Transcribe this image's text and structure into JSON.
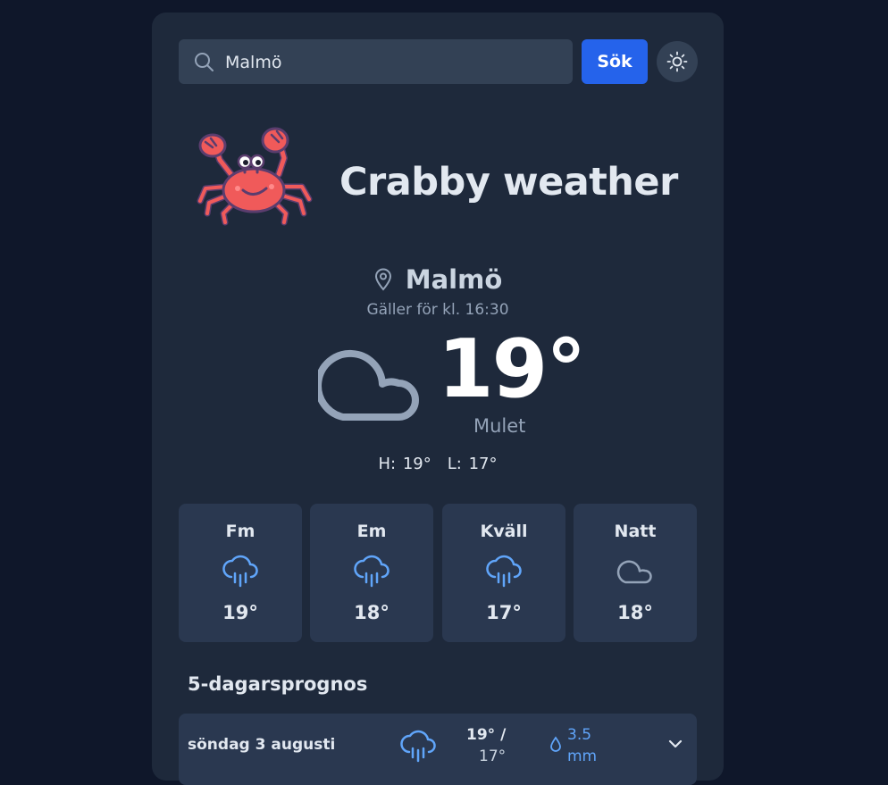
{
  "search": {
    "value": "Malmö",
    "button_label": "Sök"
  },
  "brand": {
    "title": "Crabby weather"
  },
  "current": {
    "location": "Malmö",
    "valid_time": "Gäller för kl. 16:30",
    "temperature": "19°",
    "condition": "Mulet",
    "high": "H: 19°",
    "low": "L: 17°",
    "icon": "cloud-icon"
  },
  "periods": [
    {
      "label": "Fm",
      "temp": "19°",
      "icon": "rain-icon"
    },
    {
      "label": "Em",
      "temp": "18°",
      "icon": "rain-icon"
    },
    {
      "label": "Kväll",
      "temp": "17°",
      "icon": "rain-icon"
    },
    {
      "label": "Natt",
      "temp": "18°",
      "icon": "cloud-icon"
    }
  ],
  "forecast": {
    "title": "5-dagarsprognos",
    "days": [
      {
        "name": "söndag 3 augusti",
        "high": "19° /",
        "low": "17°",
        "rain": "3.5 mm",
        "icon": "rain-icon"
      }
    ]
  },
  "colors": {
    "accent": "#2563eb",
    "rain": "#60a5fa",
    "cloud": "#94a3b8",
    "crab": "#f05a5a"
  }
}
